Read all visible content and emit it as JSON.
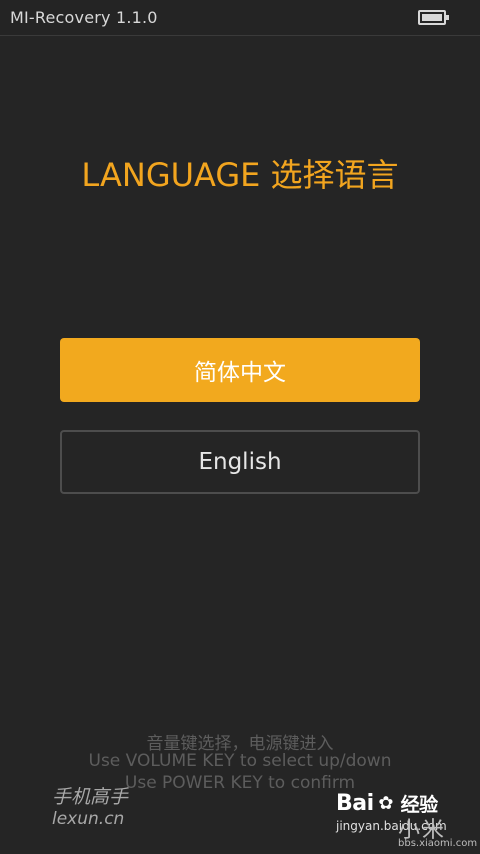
{
  "status_bar": {
    "title": "MI-Recovery 1.1.0",
    "battery_icon": "battery-charging-icon"
  },
  "heading": "LANGUAGE 选择语言",
  "languages": [
    {
      "label": "简体中文",
      "selected": true
    },
    {
      "label": "English",
      "selected": false
    }
  ],
  "hints": {
    "line1": "音量键选择，电源键进入",
    "line2": "Use VOLUME KEY to select up/down",
    "line3": "Use POWER KEY to confirm"
  },
  "watermarks": {
    "left_line1": "手机高手",
    "left_line2": "lexun.cn",
    "baidu_brand": "Bai",
    "baidu_brand_suffix": "经验",
    "baidu_url": "jingyan.baidu.com",
    "xiaomi_mark": "小米",
    "xiaomi_url": "bbs.xiaomi.com"
  },
  "colors": {
    "accent": "#f2a91e",
    "background": "#252525"
  }
}
